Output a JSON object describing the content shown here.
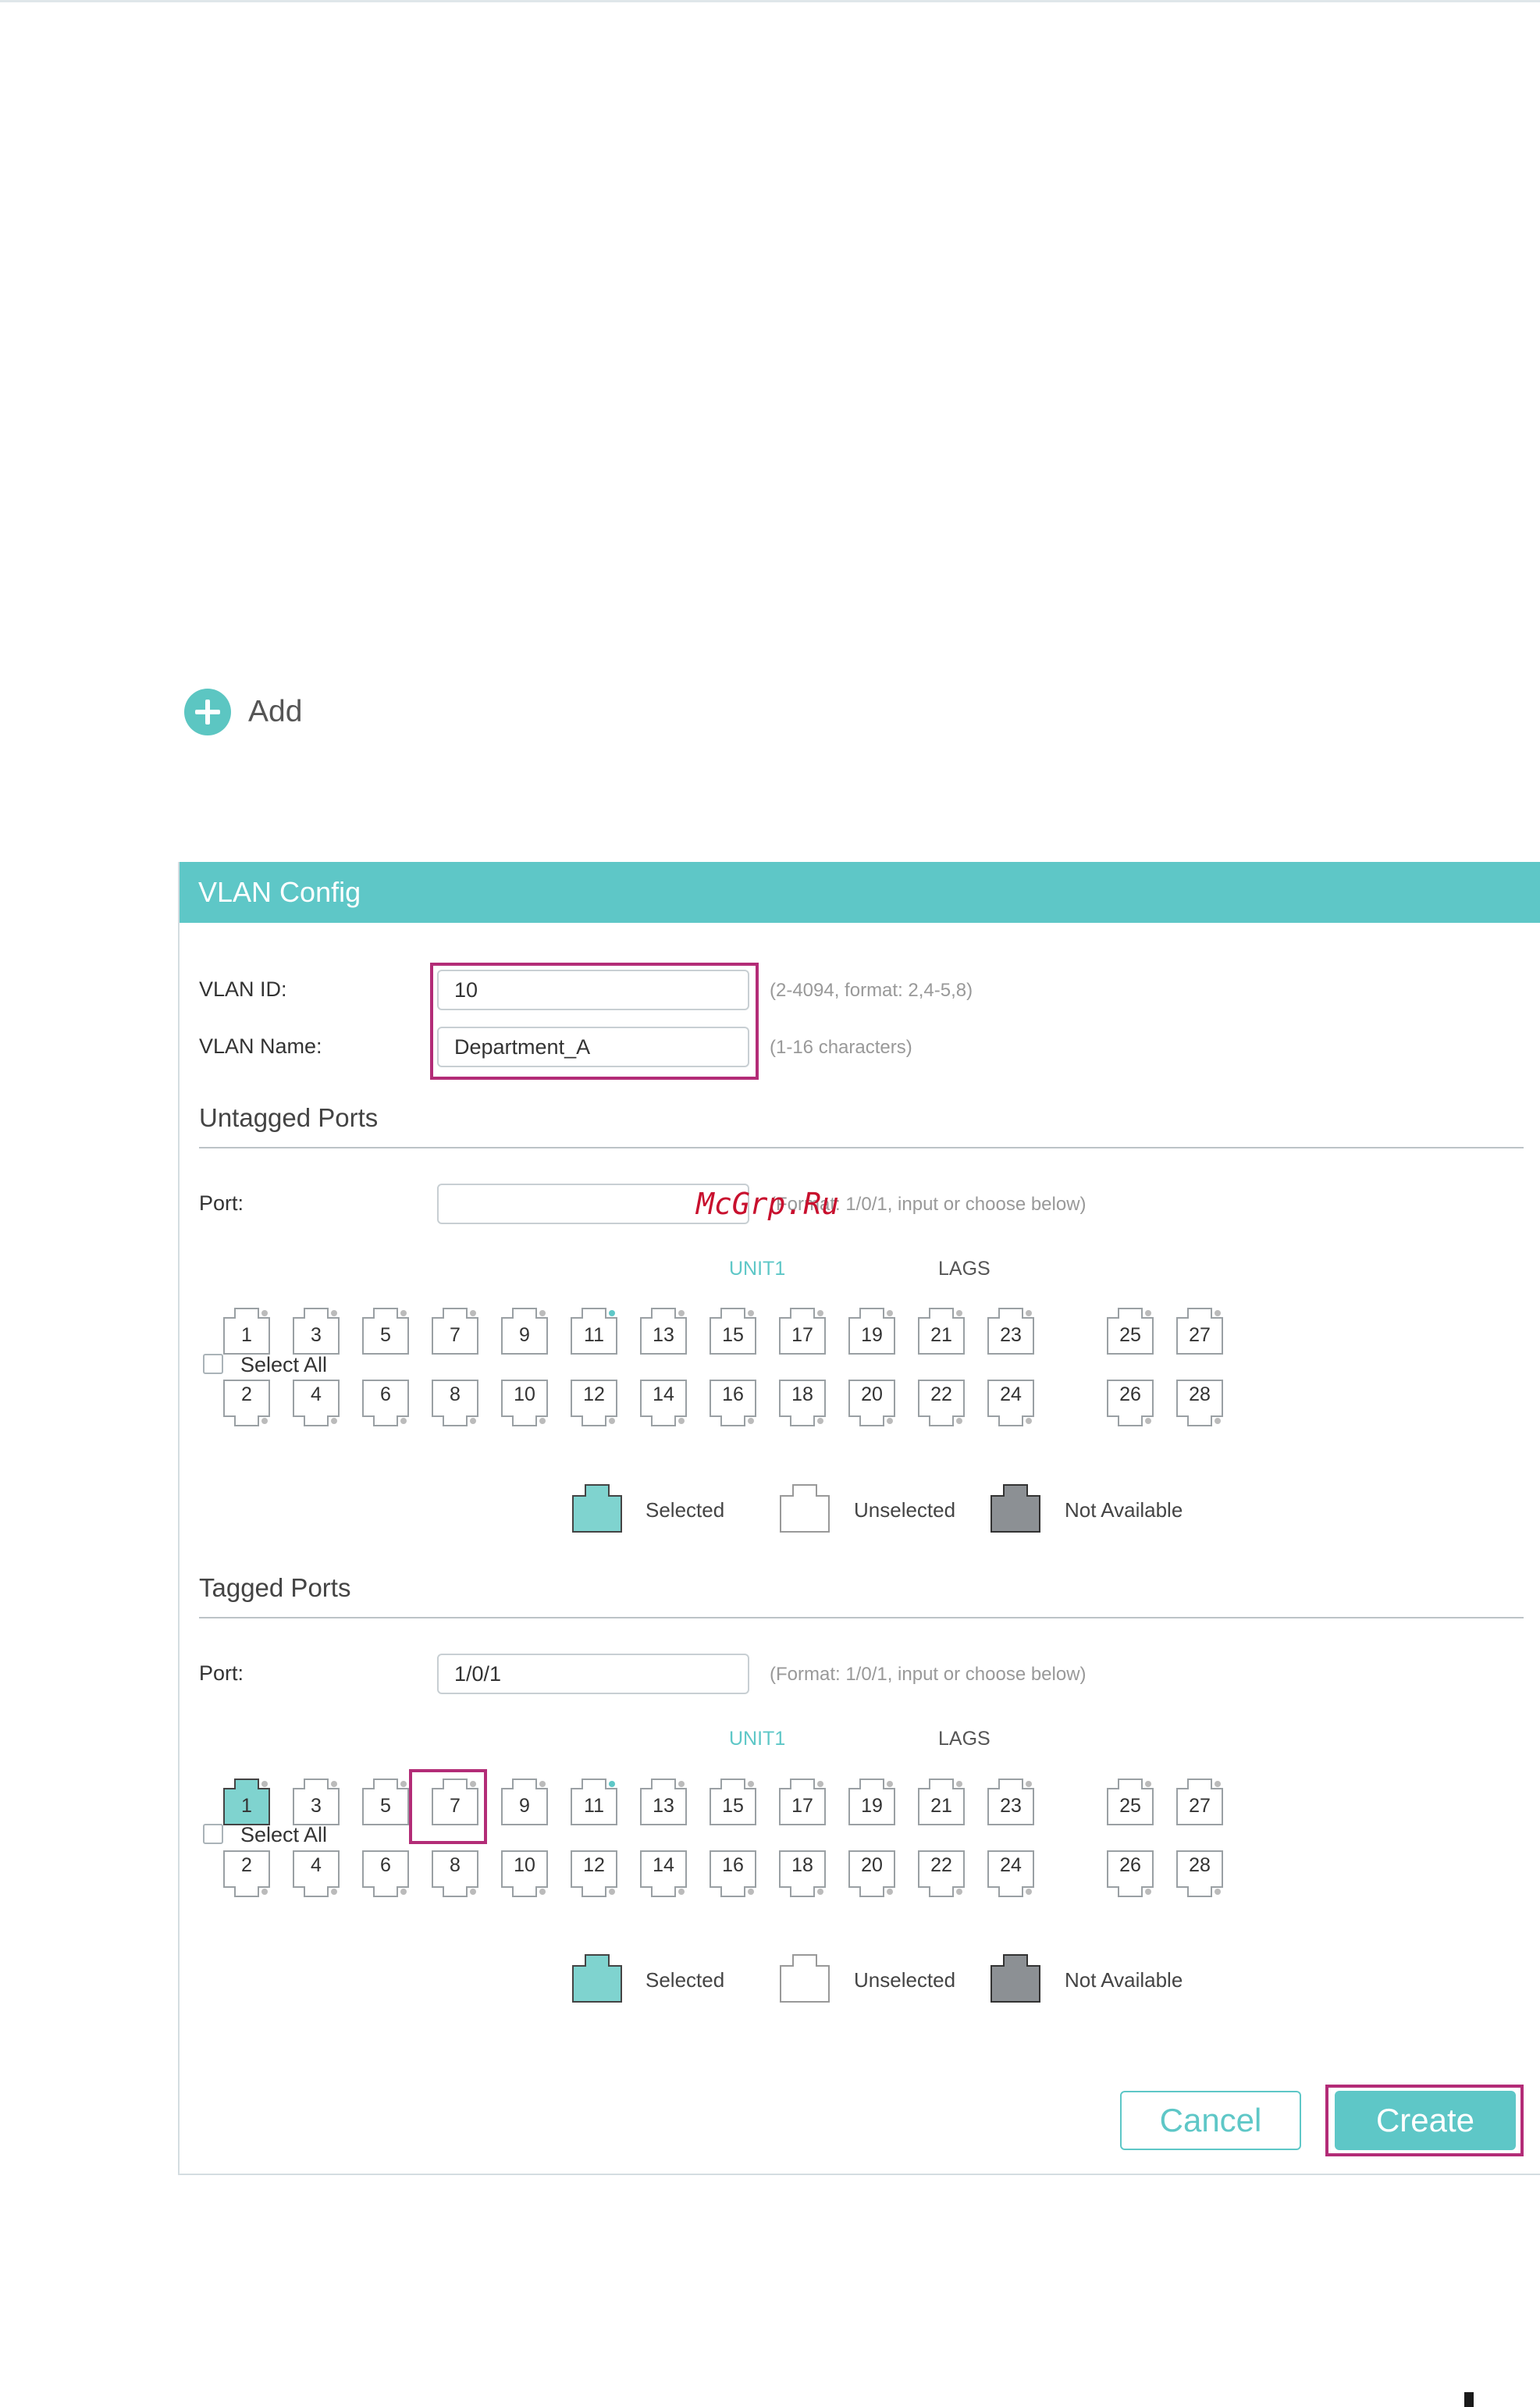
{
  "add": {
    "label": "Add"
  },
  "panel": {
    "title": "VLAN Config",
    "vlan_id": {
      "label": "VLAN ID:",
      "value": "10",
      "hint": "(2-4094, format: 2,4-5,8)"
    },
    "vlan_name": {
      "label": "VLAN Name:",
      "value": "Department_A",
      "hint": "(1-16 characters)"
    },
    "untagged": {
      "title": "Untagged Ports",
      "port_label": "Port:",
      "port_value": "",
      "hint": "(Format: 1/0/1, input or choose below)",
      "unit_label": "UNIT1",
      "lags_label": "LAGS",
      "select_all": "Select All",
      "selected_ports": []
    },
    "tagged": {
      "title": "Tagged Ports",
      "port_label": "Port:",
      "port_value": "1/0/1",
      "hint": "(Format: 1/0/1, input or choose below)",
      "unit_label": "UNIT1",
      "lags_label": "LAGS",
      "select_all": "Select All",
      "selected_ports": [
        "1"
      ]
    },
    "ports": {
      "top": [
        "1",
        "3",
        "5",
        "7",
        "9",
        "11",
        "13",
        "15",
        "17",
        "19",
        "21",
        "23",
        "25",
        "27"
      ],
      "bottom": [
        "2",
        "4",
        "6",
        "8",
        "10",
        "12",
        "14",
        "16",
        "18",
        "20",
        "22",
        "24",
        "26",
        "28"
      ]
    },
    "legend": {
      "selected": "Selected",
      "unselected": "Unselected",
      "not_available": "Not Available"
    },
    "buttons": {
      "cancel": "Cancel",
      "create": "Create"
    }
  },
  "watermark": "McGrp.Ru",
  "colors": {
    "accent": "#5ec7c7",
    "highlight": "#b32c77",
    "not_available": "#8c9094",
    "selected_fill": "#7fd3cf"
  }
}
